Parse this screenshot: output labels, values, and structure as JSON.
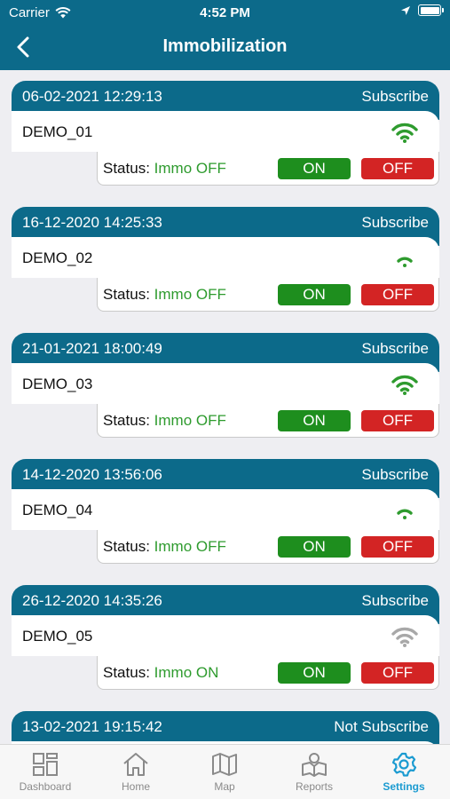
{
  "status_bar": {
    "carrier": "Carrier",
    "time": "4:52 PM"
  },
  "nav": {
    "title": "Immobilization"
  },
  "status_label": "Status:",
  "vehicles": [
    {
      "date": "06-02-2021 12:29:13",
      "subscription": "Subscribe",
      "name": "DEMO_01",
      "signal": "wifi-strong",
      "status": "Immo OFF",
      "on_label": "ON",
      "off_label": "OFF"
    },
    {
      "date": "16-12-2020 14:25:33",
      "subscription": "Subscribe",
      "name": "DEMO_02",
      "signal": "wifi-weak",
      "status": "Immo OFF",
      "on_label": "ON",
      "off_label": "OFF"
    },
    {
      "date": "21-01-2021 18:00:49",
      "subscription": "Subscribe",
      "name": "DEMO_03",
      "signal": "wifi-strong",
      "status": "Immo OFF",
      "on_label": "ON",
      "off_label": "OFF"
    },
    {
      "date": "14-12-2020 13:56:06",
      "subscription": "Subscribe",
      "name": "DEMO_04",
      "signal": "wifi-weak",
      "status": "Immo OFF",
      "on_label": "ON",
      "off_label": "OFF"
    },
    {
      "date": "26-12-2020 14:35:26",
      "subscription": "Subscribe",
      "name": "DEMO_05",
      "signal": "wifi-offline",
      "status": "Immo ON",
      "on_label": "ON",
      "off_label": "OFF"
    },
    {
      "date": "13-02-2021 19:15:42",
      "subscription": "Not Subscribe"
    }
  ],
  "tabs": [
    {
      "label": "Dashboard",
      "icon": "dashboard-icon",
      "active": false
    },
    {
      "label": "Home",
      "icon": "home-icon",
      "active": false
    },
    {
      "label": "Map",
      "icon": "map-icon",
      "active": false
    },
    {
      "label": "Reports",
      "icon": "reports-icon",
      "active": false
    },
    {
      "label": "Settings",
      "icon": "settings-icon",
      "active": true
    }
  ],
  "colors": {
    "primary": "#0c6a8a",
    "on": "#1e8e1e",
    "off": "#d32424",
    "status_text": "#2e9b2e",
    "active_tab": "#1b9bd1"
  }
}
